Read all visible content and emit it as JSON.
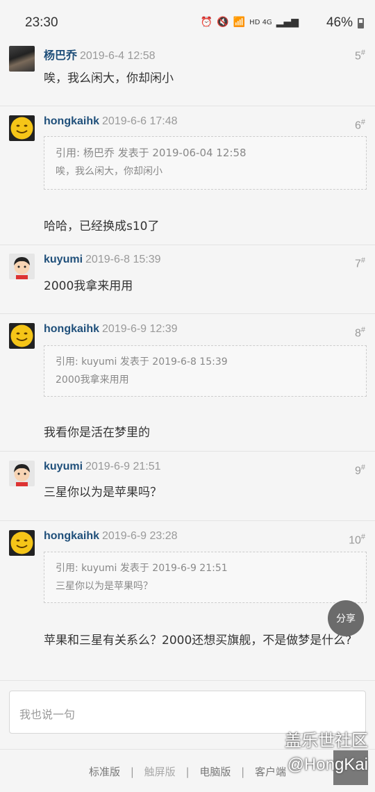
{
  "status_bar": {
    "time": "23:30",
    "battery": "46%",
    "network": "HD 4G"
  },
  "posts": [
    {
      "author": "杨巴乔",
      "date": "2019-6-4 12:58",
      "floor": "5",
      "content": "唉，我么闲大，你却闲小",
      "avatar": "photo-avatar"
    },
    {
      "author": "hongkaihk",
      "date": "2019-6-6 17:48",
      "floor": "6",
      "quote_head": "引用: 杨巴乔 发表于 2019-06-04 12:58",
      "quote_body": "唉，我么闲大，你却闲小",
      "content": "哈哈，已经换成s10了",
      "avatar": "smiley-avatar"
    },
    {
      "author": "kuyumi",
      "date": "2019-6-8 15:39",
      "floor": "7",
      "content": "2000我拿来用用",
      "avatar": "cartoon-boy-avatar"
    },
    {
      "author": "hongkaihk",
      "date": "2019-6-9 12:39",
      "floor": "8",
      "quote_head": "引用: kuyumi 发表于 2019-6-8 15:39",
      "quote_body": "2000我拿来用用",
      "content": "我看你是活在梦里的",
      "avatar": "smiley-avatar"
    },
    {
      "author": "kuyumi",
      "date": "2019-6-9 21:51",
      "floor": "9",
      "content": "三星你以为是苹果吗？",
      "avatar": "cartoon-boy-avatar"
    },
    {
      "author": "hongkaihk",
      "date": "2019-6-9 23:28",
      "floor": "10",
      "quote_head": "引用: kuyumi 发表于 2019-6-9 21:51",
      "quote_body": "三星你以为是苹果吗？",
      "content": "苹果和三星有关系么？2000还想买旗舰，不是做梦是什么?",
      "avatar": "smiley-avatar"
    }
  ],
  "floor_mark": "#",
  "share_label": "分享",
  "reply_placeholder": "我也说一句",
  "footer": {
    "standard": "标准版",
    "touch": "触屏版",
    "desktop": "电脑版",
    "client": "客户端",
    "separator": "|"
  },
  "watermark": {
    "line1": "盖乐世社区",
    "line2": "@HongKai"
  }
}
